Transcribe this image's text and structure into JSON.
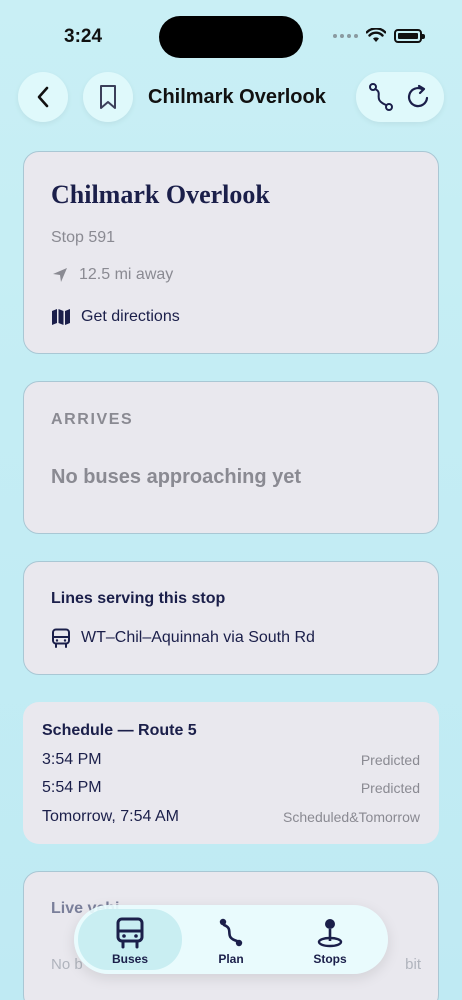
{
  "status_bar": {
    "time": "3:24"
  },
  "nav": {
    "title": "Chilmark Overlook"
  },
  "stop_info": {
    "name": "Chilmark Overlook",
    "stop_number": "Stop 591",
    "distance": "12.5 mi away",
    "directions_label": "Get directions"
  },
  "arrives": {
    "label": "ARRIVES",
    "empty_message": "No buses approaching yet"
  },
  "lines": {
    "title": "Lines serving this stop",
    "items": [
      {
        "label": "WT–Chil–Aquinnah via South Rd"
      }
    ]
  },
  "schedule": {
    "title": "Schedule — Route 5",
    "rows": [
      {
        "time": "3:54 PM",
        "status": "Predicted"
      },
      {
        "time": "5:54 PM",
        "status": "Predicted"
      },
      {
        "time": "Tomorrow, 7:54 AM",
        "status": "Scheduled&Tomorrow"
      }
    ]
  },
  "live": {
    "title": "Live vehi",
    "text_start": "No b",
    "text_end": "bit"
  },
  "tabs": [
    {
      "label": "Buses",
      "icon": "bus-icon",
      "selected": true
    },
    {
      "label": "Plan",
      "icon": "route-icon",
      "selected": false
    },
    {
      "label": "Stops",
      "icon": "map-pin-icon",
      "selected": false
    }
  ],
  "colors": {
    "navy": "#1b1f4a",
    "muted": "#8a8a92",
    "background": "#c4edf4",
    "card": "#e9e8ee"
  }
}
